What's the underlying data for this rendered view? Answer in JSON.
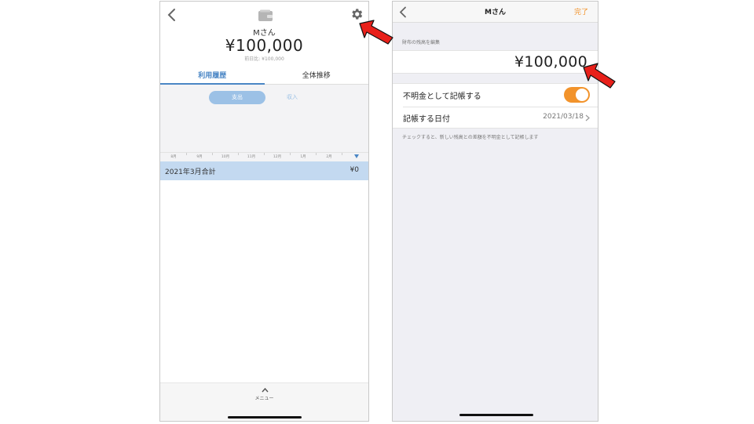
{
  "left": {
    "account_name": "Mさん",
    "balance": "¥100,000",
    "sub_text": "前日比: ¥100,000",
    "tabs": [
      {
        "label": "利用履歴",
        "active": true
      },
      {
        "label": "全体推移",
        "active": false
      }
    ],
    "segment": {
      "expense": "支出",
      "income": "収入",
      "selected": "支出"
    },
    "months": [
      "8月",
      "9月",
      "10月",
      "11月",
      "12月",
      "1月",
      "2月"
    ],
    "total_label": "2021年3月合計",
    "total_value": "¥0",
    "menu_label": "メニュー",
    "icons": [
      "back-chevron-icon",
      "wallet-icon",
      "gear-icon",
      "chevron-up-icon"
    ]
  },
  "right": {
    "nav_title": "Mさん",
    "done_label": "完了",
    "section_label": "財布の残高を編集",
    "balance": "¥100,000",
    "rows": [
      {
        "label": "不明金として記帳する",
        "toggle_on": true
      },
      {
        "label": "記帳する日付",
        "value": "2021/03/18"
      }
    ],
    "note": "チェックすると、新しい残高との差額を不明金として記帳します",
    "icons": [
      "back-chevron-icon",
      "chevron-right-icon"
    ]
  },
  "colors": {
    "accent_blue": "#4a86c5",
    "accent_orange": "#f2932b",
    "arrow_red": "#e8201a"
  }
}
